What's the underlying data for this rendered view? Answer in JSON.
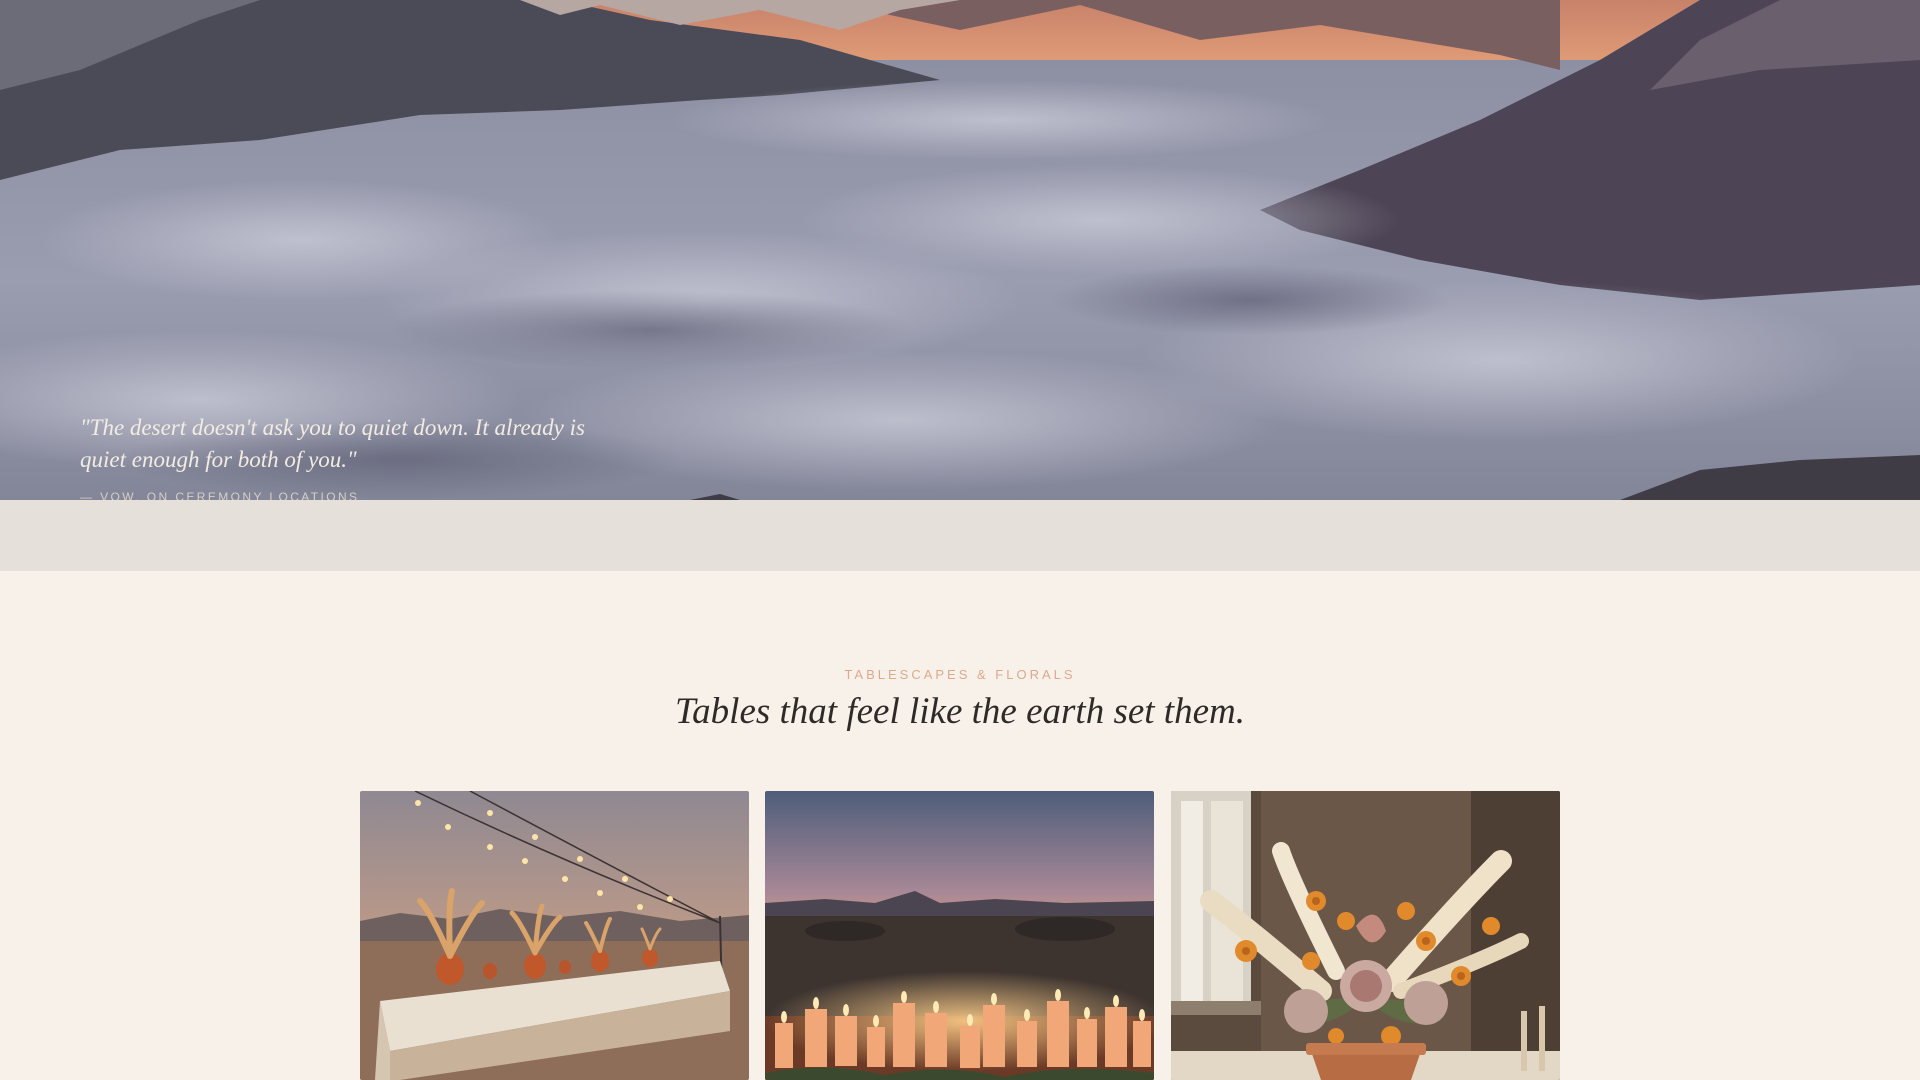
{
  "hero": {
    "quote": "\"The desert doesn't ask you to quiet down. It already is quiet enough for both of you.\"",
    "attribution": "— VOW, ON CEREMONY LOCATIONS",
    "image": "mountain-sea-of-clouds-sunset"
  },
  "section": {
    "eyebrow": "TABLESCAPES & FLORALS",
    "headline": "Tables that feel like the earth set them."
  },
  "gallery": [
    {
      "image": "desert-banquet-table-string-lights"
    },
    {
      "image": "candles-desert-sunset"
    },
    {
      "image": "pampas-marigold-protea-bouquet"
    }
  ],
  "colors": {
    "page_background": "#f8f1ea",
    "band": "#e6e0da",
    "eyebrow": "#dca98c",
    "headline": "#2e2a27"
  }
}
